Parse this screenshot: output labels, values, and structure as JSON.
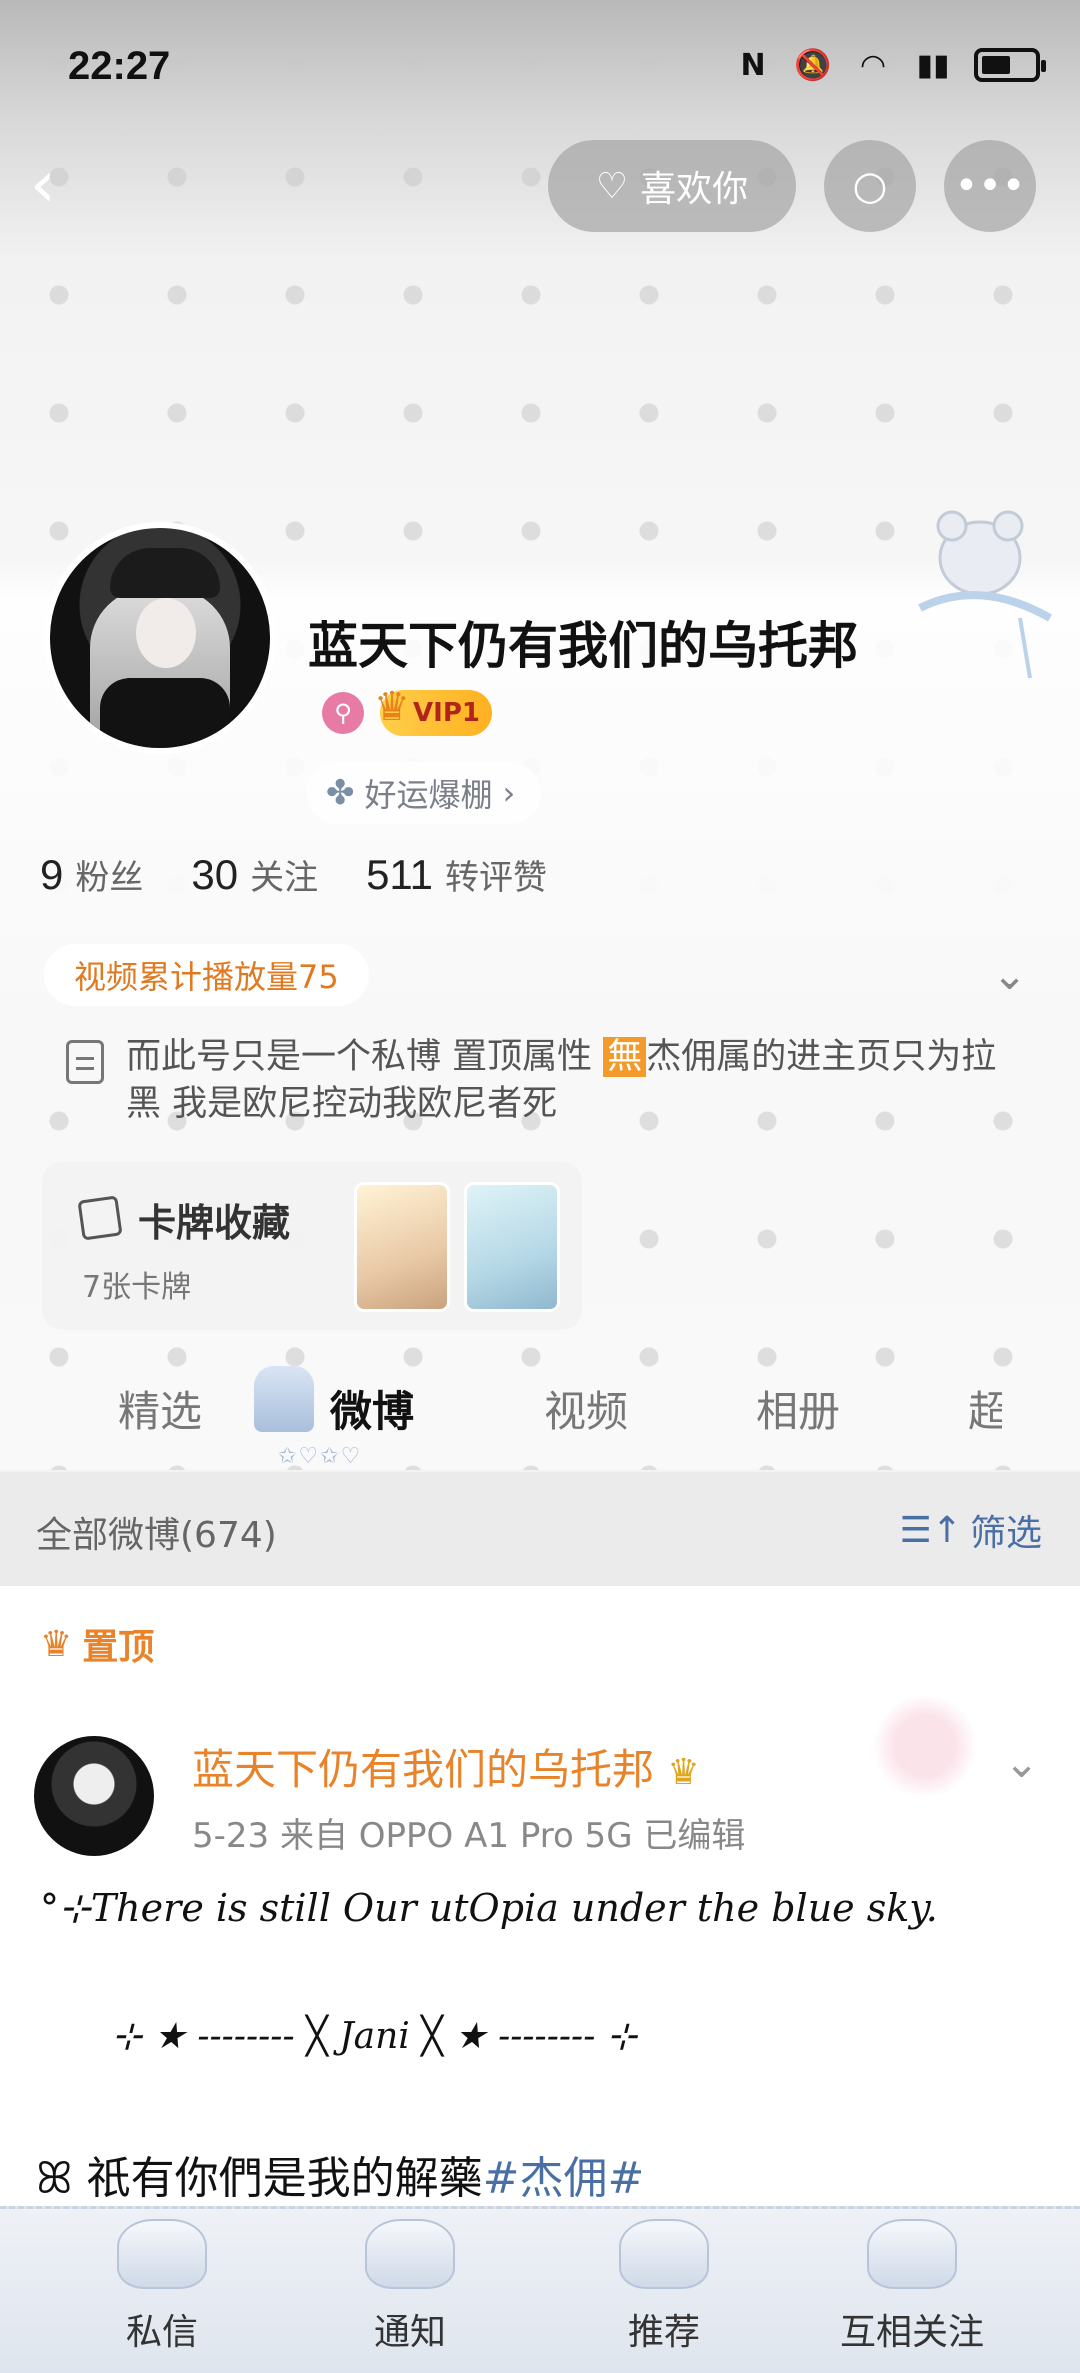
{
  "status_bar": {
    "time": "22:27",
    "icons": [
      "nfc-icon",
      "mute-icon",
      "wifi-icon",
      "signal-5g-icon",
      "battery-icon"
    ]
  },
  "top_nav": {
    "like_label": "喜欢你"
  },
  "profile": {
    "username": "蓝天下仍有我们的乌托邦",
    "vip_label": "VIP1",
    "luck_label": "好运爆棚",
    "stats": [
      {
        "num": "9",
        "label": "粉丝"
      },
      {
        "num": "30",
        "label": "关注"
      },
      {
        "num": "511",
        "label": "转评赞"
      }
    ],
    "video_plays": "视频累计播放量75",
    "bio_part1": "而此号只是一个私博 置顶属性 ",
    "bio_highlight": "無",
    "bio_part2": "杰佣属的进主页只为拉黑 我是欧尼控动我欧尼者死",
    "cards": {
      "title": "卡牌收藏",
      "count": "7张卡牌"
    }
  },
  "tabs": [
    "精选",
    "微博",
    "视频",
    "相册",
    "超"
  ],
  "active_tab": "微博",
  "filter": {
    "count_label": "全部微博(674)",
    "filter_label": "筛选"
  },
  "post": {
    "pinned_label": "置顶",
    "author": "蓝天下仍有我们的乌托邦",
    "meta": "5-23  来自 OPPO A1 Pro 5G  已编辑",
    "line1": "°⊹There is still Our utOpia under the blue sky.",
    "line2": "⊹ ★ -------- ╳ Jani ╳ ★ -------- ⊹",
    "line3_text": "ꕤ 祇有你們是我的解藥",
    "line3_tag": "#杰佣#"
  },
  "bottom_nav": [
    "私信",
    "通知",
    "推荐",
    "互相关注"
  ],
  "colors": {
    "accent_orange": "#e8832a",
    "link_blue": "#4a6fa5",
    "vip_gold": "#ffb020"
  }
}
